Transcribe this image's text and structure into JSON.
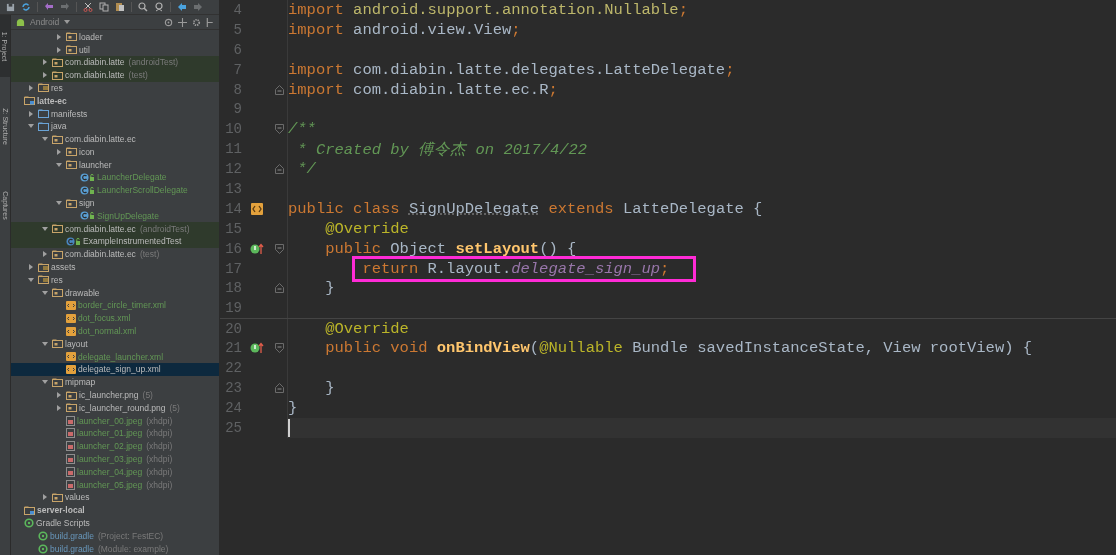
{
  "toolbar": {
    "buttons": [
      {
        "kind": "save"
      },
      {
        "kind": "sync"
      },
      {
        "kind": "undo"
      },
      {
        "kind": "redo"
      },
      {
        "kind": "cut"
      },
      {
        "kind": "copy"
      },
      {
        "kind": "paste"
      },
      {
        "kind": "find"
      },
      {
        "kind": "replace"
      },
      {
        "kind": "back"
      },
      {
        "kind": "forward"
      }
    ]
  },
  "tool_windows": [
    {
      "label": "1: Project",
      "selected": true
    },
    {
      "label": "Z: Structure",
      "selected": false
    },
    {
      "label": "Captures",
      "selected": false
    }
  ],
  "project": {
    "view": "Android",
    "items": [
      {
        "children": [
          {
            "children": [
              {
                "children": [
                  {
                    "label": "loader",
                    "kind": "package",
                    "expanded": false,
                    "selected": false
                  },
                  {
                    "label": "util",
                    "kind": "package",
                    "expanded": false,
                    "selected": false
                  }
                ]
              },
              {
                "label": "com.diabin.latte",
                "suffix": "(androidTest)",
                "kind": "package",
                "expanded": false,
                "test_scope": true,
                "selected": false
              },
              {
                "label": "com.diabin.latte",
                "suffix": "(test)",
                "kind": "package",
                "expanded": false,
                "test_scope": true,
                "selected": false
              }
            ]
          },
          {
            "label": "res",
            "kind": "res-folder",
            "expanded": false,
            "selected": false
          }
        ]
      },
      {
        "label": "latte-ec",
        "kind": "module",
        "selected": false,
        "children": [
          {
            "label": "manifests",
            "kind": "source-folder",
            "expanded": false,
            "selected": false
          },
          {
            "label": "java",
            "kind": "source-folder",
            "expanded": true,
            "selected": false,
            "children": [
              {
                "label": "com.diabin.latte.ec",
                "kind": "package",
                "expanded": true,
                "selected": false,
                "children": [
                  {
                    "label": "icon",
                    "kind": "package",
                    "expanded": false,
                    "selected": false
                  },
                  {
                    "label": "launcher",
                    "kind": "package",
                    "expanded": true,
                    "selected": false,
                    "children": [
                      {
                        "label": "LauncherDelegate",
                        "kind": "class",
                        "added": true,
                        "selected": false
                      },
                      {
                        "label": "LauncherScrollDelegate",
                        "kind": "class",
                        "added": true,
                        "selected": false
                      }
                    ]
                  },
                  {
                    "label": "sign",
                    "kind": "package",
                    "expanded": true,
                    "selected": false,
                    "children": [
                      {
                        "label": "SignUpDelegate",
                        "kind": "class",
                        "added": true,
                        "selected": false
                      }
                    ]
                  }
                ]
              },
              {
                "label": "com.diabin.latte.ec",
                "suffix": "(androidTest)",
                "kind": "package",
                "expanded": true,
                "test_scope": true,
                "selected": false,
                "children": [
                  {
                    "label": "ExampleInstrumentedTest",
                    "kind": "test-class",
                    "test_scope": true,
                    "selected": false
                  }
                ]
              },
              {
                "label": "com.diabin.latte.ec",
                "suffix": "(test)",
                "kind": "package",
                "expanded": false,
                "selected": false
              }
            ]
          },
          {
            "label": "assets",
            "kind": "res-folder",
            "expanded": false,
            "selected": false
          },
          {
            "label": "res",
            "kind": "res-folder",
            "expanded": true,
            "selected": false,
            "children": [
              {
                "label": "drawable",
                "kind": "package",
                "expanded": true,
                "selected": false,
                "children": [
                  {
                    "label": "border_circle_timer.xml",
                    "kind": "xml",
                    "added": true,
                    "selected": false
                  },
                  {
                    "label": "dot_focus.xml",
                    "kind": "xml",
                    "added": true,
                    "selected": false
                  },
                  {
                    "label": "dot_normal.xml",
                    "kind": "xml",
                    "added": true,
                    "selected": false
                  }
                ]
              },
              {
                "label": "layout",
                "kind": "package",
                "expanded": true,
                "selected": false,
                "children": [
                  {
                    "label": "delegate_launcher.xml",
                    "kind": "xml",
                    "added": true,
                    "selected": false
                  },
                  {
                    "label": "delegate_sign_up.xml",
                    "kind": "xml",
                    "selected": true
                  }
                ]
              },
              {
                "label": "mipmap",
                "kind": "package",
                "expanded": true,
                "selected": false,
                "children": [
                  {
                    "label": "ic_launcher.png",
                    "suffix": "(5)",
                    "kind": "package",
                    "expanded": false,
                    "selected": false
                  },
                  {
                    "label": "ic_launcher_round.png",
                    "suffix": "(5)",
                    "kind": "package",
                    "expanded": false,
                    "selected": false
                  },
                  {
                    "label": "launcher_00.jpeg",
                    "suffix": "(xhdpi)",
                    "kind": "image",
                    "added": true,
                    "selected": false
                  },
                  {
                    "label": "launcher_01.jpeg",
                    "suffix": "(xhdpi)",
                    "kind": "image",
                    "added": true,
                    "selected": false
                  },
                  {
                    "label": "launcher_02.jpeg",
                    "suffix": "(xhdpi)",
                    "kind": "image",
                    "added": true,
                    "selected": false
                  },
                  {
                    "label": "launcher_03.jpeg",
                    "suffix": "(xhdpi)",
                    "kind": "image",
                    "added": true,
                    "selected": false
                  },
                  {
                    "label": "launcher_04.jpeg",
                    "suffix": "(xhdpi)",
                    "kind": "image",
                    "added": true,
                    "selected": false
                  },
                  {
                    "label": "launcher_05.jpeg",
                    "suffix": "(xhdpi)",
                    "kind": "image",
                    "added": true,
                    "selected": false
                  }
                ]
              },
              {
                "label": "values",
                "kind": "package",
                "expanded": false,
                "selected": false
              }
            ]
          }
        ]
      },
      {
        "label": "server-local",
        "kind": "module",
        "selected": false
      },
      {
        "label": "Gradle Scripts",
        "kind": "gradle",
        "selected": false,
        "children": [
          {
            "label": "build.gradle",
            "suffix": "(Project: FestEC)",
            "kind": "gradle",
            "modified": true,
            "selected": false
          },
          {
            "label": "build.gradle",
            "suffix": "(Module: example)",
            "kind": "gradle",
            "modified": true,
            "selected": false
          }
        ]
      }
    ]
  },
  "editor": {
    "lines": [
      {
        "number": "4",
        "tokens": [
          {
            "text": "import",
            "kind": "keyword"
          },
          {
            "text": " android.support.annotation.Nullable",
            "kind": "unused"
          },
          {
            "text": ";",
            "kind": "keyword"
          }
        ]
      },
      {
        "number": "5",
        "tokens": [
          {
            "text": "import",
            "kind": "keyword"
          },
          {
            "text": " android.view.View",
            "kind": "plain"
          },
          {
            "text": ";",
            "kind": "keyword"
          }
        ]
      },
      {
        "number": "6"
      },
      {
        "number": "7",
        "tokens": [
          {
            "text": "import",
            "kind": "keyword"
          },
          {
            "text": " com.diabin.latte.delegates.LatteDelegate",
            "kind": "plain"
          },
          {
            "text": ";",
            "kind": "keyword"
          }
        ]
      },
      {
        "number": "8",
        "fold_end": true,
        "tokens": [
          {
            "text": "import",
            "kind": "keyword"
          },
          {
            "text": " com.diabin.latte.ec.R",
            "kind": "plain"
          },
          {
            "text": ";",
            "kind": "keyword"
          }
        ]
      },
      {
        "number": "9"
      },
      {
        "number": "10",
        "fold_start": true,
        "tokens": [
          {
            "text": "/**",
            "kind": "comment"
          }
        ]
      },
      {
        "number": "11",
        "tokens": [
          {
            "text": " * Created by 傅令杰 on 2017/4/22",
            "kind": "comment"
          }
        ]
      },
      {
        "number": "12",
        "fold_end": true,
        "tokens": [
          {
            "text": " */",
            "kind": "comment"
          }
        ]
      },
      {
        "number": "13"
      },
      {
        "number": "14",
        "layout_marker": true,
        "tokens": [
          {
            "text": "public class ",
            "kind": "keyword"
          },
          {
            "text": "SignUpDelegate",
            "kind": "declaration"
          },
          {
            "text": " extends ",
            "kind": "keyword"
          },
          {
            "text": "LatteDelegate {",
            "kind": "plain"
          }
        ]
      },
      {
        "number": "15",
        "in_class": true,
        "tokens": [
          {
            "text": "@Override",
            "kind": "annotation"
          }
        ]
      },
      {
        "number": "16",
        "in_class": true,
        "override_marker": true,
        "fold_start": true,
        "tokens": [
          {
            "text": "public ",
            "kind": "keyword"
          },
          {
            "text": "Object ",
            "kind": "plain"
          },
          {
            "text": "setLayout",
            "kind": "method"
          },
          {
            "text": "() {",
            "kind": "plain"
          }
        ]
      },
      {
        "number": "17",
        "in_class": true,
        "in_method": true,
        "highlight": true,
        "tokens": [
          {
            "text": "return ",
            "kind": "keyword"
          },
          {
            "text": "R.layout.",
            "kind": "plain"
          },
          {
            "text": "delegate_sign_up",
            "kind": "field"
          },
          {
            "text": ";",
            "kind": "keyword"
          }
        ]
      },
      {
        "number": "18",
        "in_class": true,
        "fold_end": true,
        "tokens": [
          {
            "text": "}",
            "kind": "plain"
          }
        ]
      },
      {
        "number": "19"
      },
      {
        "number": "20",
        "in_class": true,
        "separator_above": true,
        "tokens": [
          {
            "text": "@Override",
            "kind": "annotation"
          }
        ]
      },
      {
        "number": "21",
        "in_class": true,
        "override_marker": true,
        "fold_start": true,
        "tokens": [
          {
            "text": "public void ",
            "kind": "keyword"
          },
          {
            "text": "onBindView",
            "kind": "method"
          },
          {
            "text": "(",
            "kind": "plain"
          },
          {
            "text": "@Nullable ",
            "kind": "annotation"
          },
          {
            "text": "Bundle savedInstanceState, View rootView) {",
            "kind": "plain"
          }
        ]
      },
      {
        "number": "22"
      },
      {
        "number": "23",
        "in_class": true,
        "fold_end": true,
        "tokens": [
          {
            "text": "}",
            "kind": "plain"
          }
        ]
      },
      {
        "number": "24",
        "tokens": [
          {
            "text": "}",
            "kind": "plain"
          }
        ]
      },
      {
        "number": "25",
        "current": true
      }
    ]
  }
}
